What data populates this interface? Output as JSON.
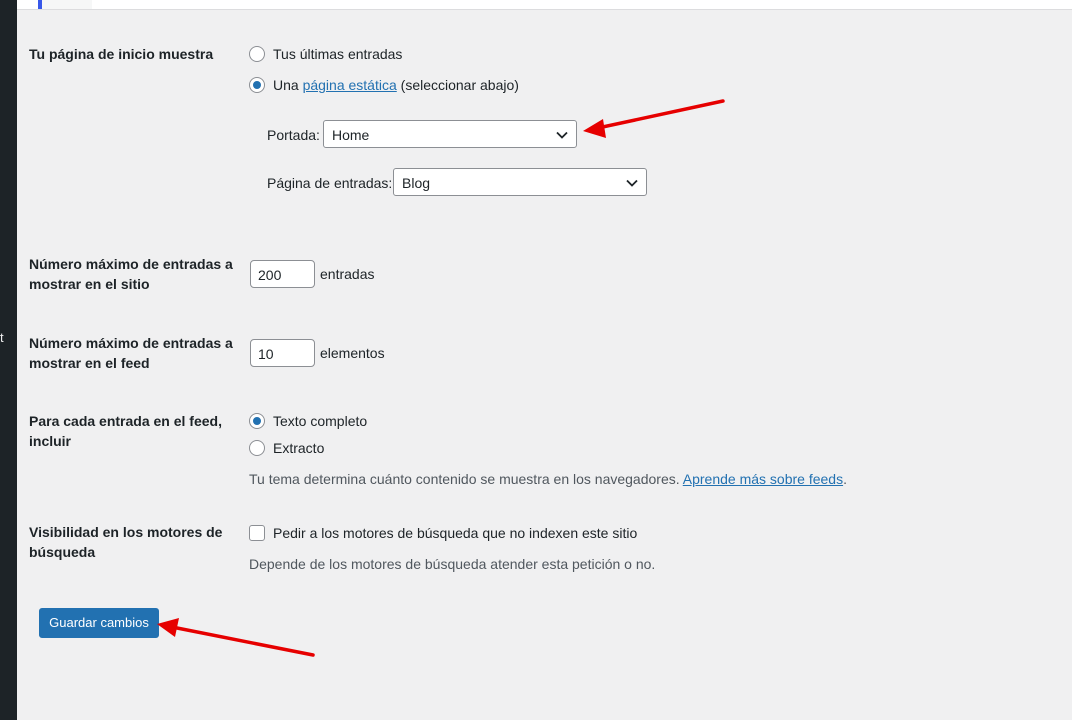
{
  "sidebar": {
    "edge_text": "t"
  },
  "homepage": {
    "label": "Tu página de inicio muestra",
    "options": {
      "latest": "Tus últimas entradas",
      "static_prefix": "Una",
      "static_link": "página estática",
      "static_suffix": "(seleccionar abajo)"
    },
    "selected": "static",
    "front_page": {
      "label": "Portada:",
      "value": "Home"
    },
    "posts_page": {
      "label": "Página de entradas:",
      "value": "Blog"
    }
  },
  "posts_per_page": {
    "label": "Número máximo de entradas a mostrar en el sitio",
    "value": "200",
    "unit": "entradas"
  },
  "posts_per_rss": {
    "label": "Número máximo de entradas a mostrar en el feed",
    "value": "10",
    "unit": "elementos"
  },
  "feed_content": {
    "label": "Para cada entrada en el feed, incluir",
    "options": {
      "full": "Texto completo",
      "excerpt": "Extracto"
    },
    "selected": "full",
    "desc_text": "Tu tema determina cuánto contenido se muestra en los navegadores.",
    "desc_link": "Aprende más sobre feeds",
    "desc_end": "."
  },
  "search_visibility": {
    "label": "Visibilidad en los motores de búsqueda",
    "checkbox_label": "Pedir a los motores de búsqueda que no indexen este sitio",
    "checked": false,
    "desc": "Depende de los motores de búsqueda atender esta petición o no."
  },
  "submit": {
    "label": "Guardar cambios"
  },
  "colors": {
    "accent": "#2271b1",
    "annotation": "#e60000",
    "admin_bar": "#1d2327",
    "background": "#f0f0f1"
  },
  "annotations": [
    "arrow-to-portada-select",
    "arrow-to-save-button"
  ]
}
